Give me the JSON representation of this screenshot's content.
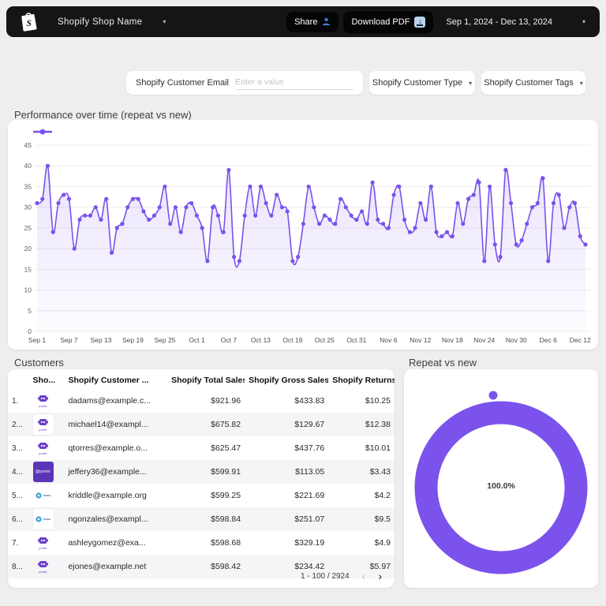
{
  "theme": {
    "accent_purple": "#7b52ec",
    "area_fill": "#7b52ec",
    "header_bg": "#151515",
    "blue_icon": "#3d7fd9",
    "download_badge_bg": "#b9d2ec",
    "page_bg": "#efeeee",
    "row_alt_bg": "#f5f4f6"
  },
  "icons": {
    "chevron_down": "▾",
    "sort_down": "▾",
    "prev": "‹",
    "next": "›",
    "arrow_down": "↓"
  },
  "header": {
    "shop_name": "Shopify Shop Name",
    "share_label": "Share",
    "download_label": "Download PDF",
    "date_range": "Sep 1, 2024 - Dec 13, 2024"
  },
  "filters": {
    "email_label": "Shopify Customer Email",
    "email_placeholder": "Enter a value",
    "email_value": "",
    "type_label": "Shopify Customer Type",
    "tags_label": "Shopify Customer Tags"
  },
  "chart_data": [
    {
      "type": "line",
      "title": "Performance over time (repeat vs new)",
      "start_date": "Sep 1",
      "end_date": "Dec 13",
      "x_tick_labels": [
        "Sep 1",
        "Sep 7",
        "Sep 13",
        "Sep 19",
        "Sep 25",
        "Oct 1",
        "Oct 7",
        "Oct 13",
        "Oct 19",
        "Oct 25",
        "Oct 31",
        "Nov 6",
        "Nov 12",
        "Nov 18",
        "Nov 24",
        "Nov 30",
        "Dec 6",
        "Dec 12"
      ],
      "x_tick_step": 6,
      "values": [
        31,
        32,
        40,
        24,
        31,
        33,
        32,
        20,
        27,
        28,
        28,
        30,
        27,
        32,
        19,
        25,
        26,
        30,
        32,
        32,
        29,
        27,
        28,
        30,
        35,
        26,
        30,
        24,
        30,
        31,
        28,
        25,
        17,
        30,
        28,
        24,
        39,
        18,
        17,
        28,
        35,
        28,
        35,
        31,
        28,
        33,
        30,
        29,
        17,
        18,
        26,
        35,
        30,
        26,
        28,
        27,
        26,
        32,
        30,
        28,
        27,
        29,
        26,
        36,
        27,
        26,
        25,
        33,
        35,
        27,
        24,
        25,
        31,
        27,
        35,
        24,
        23,
        24,
        23,
        31,
        26,
        32,
        33,
        36,
        17,
        35,
        21,
        18,
        39,
        31,
        21,
        22,
        26,
        30,
        31,
        37,
        17,
        31,
        33,
        25,
        30,
        31,
        23,
        21
      ],
      "ylim": [
        0,
        45
      ],
      "y_ticks": [
        0,
        5,
        10,
        15,
        20,
        25,
        30,
        35,
        40,
        45
      ],
      "grid": true,
      "legend_marker_only": true,
      "line_color": "#7b52ec"
    },
    {
      "type": "pie",
      "title": "Repeat vs new",
      "values": [
        100
      ],
      "center_label": "100.0%",
      "slice_color": "#7b52ec"
    }
  ],
  "customers_table": {
    "title": "Customers",
    "columns": {
      "index": "",
      "shop": "Sho...",
      "email": "Shopify Customer ...",
      "total": "Shopify Total Sales",
      "gross": "Shopify Gross Sales",
      "returns": "Shopify Returns"
    },
    "rows": [
      {
        "num": "1.",
        "icon": "porter-mascot",
        "tile": "none",
        "email": "dadams@example.c...",
        "total": "$921.96",
        "gross": "$433.83",
        "returns": "$10.25"
      },
      {
        "num": "2...",
        "icon": "porter-mascot",
        "tile": "white",
        "email": "michael14@exampl...",
        "total": "$675.82",
        "gross": "$129.67",
        "returns": "$12.38"
      },
      {
        "num": "3...",
        "icon": "porter-mascot",
        "tile": "none",
        "email": "qtorres@example.o...",
        "total": "$625.47",
        "gross": "$437.76",
        "returns": "$10.01"
      },
      {
        "num": "4...",
        "icon": "porter-wordmark",
        "tile": "purple",
        "email": "jeffery36@example...",
        "total": "$599.91",
        "gross": "$113.05",
        "returns": "$3.43"
      },
      {
        "num": "5...",
        "icon": "blue-logo",
        "tile": "none",
        "email": "kriddle@example.org",
        "total": "$599.25",
        "gross": "$221.69",
        "returns": "$4.2"
      },
      {
        "num": "6...",
        "icon": "blue-logo",
        "tile": "white",
        "email": "ngonzales@exampl...",
        "total": "$598.84",
        "gross": "$251.07",
        "returns": "$9.5"
      },
      {
        "num": "7.",
        "icon": "porter-mascot",
        "tile": "none",
        "email": "ashleygomez@exa...",
        "total": "$598.68",
        "gross": "$329.19",
        "returns": "$4.9"
      },
      {
        "num": "8...",
        "icon": "porter-mascot",
        "tile": "none",
        "email": "ejones@example.net",
        "total": "$598.42",
        "gross": "$234.42",
        "returns": "$5.97"
      }
    ],
    "pagination": "1 - 100 / 2924"
  }
}
